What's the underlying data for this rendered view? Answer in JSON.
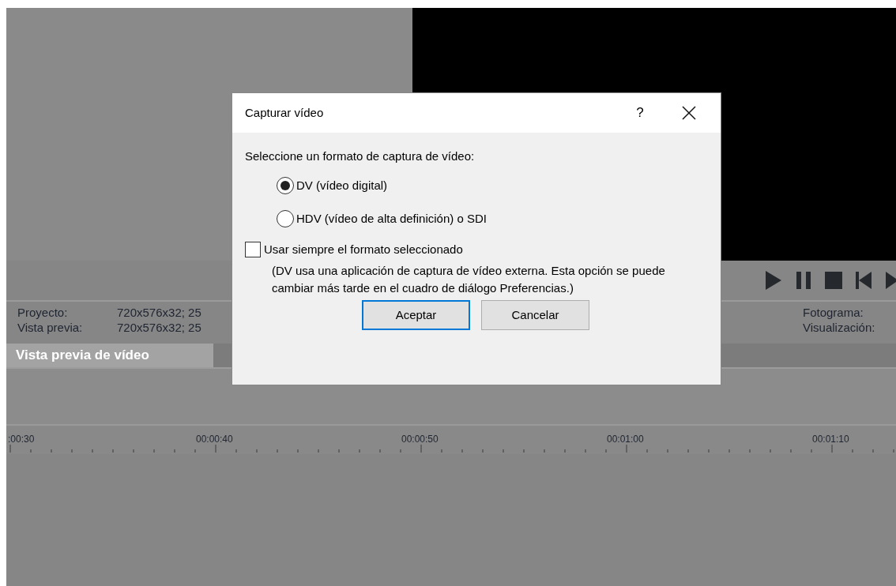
{
  "preview_info": {
    "rows": [
      {
        "label": "Proyecto:",
        "value": "720x576x32; 25"
      },
      {
        "label": "Vista previa:",
        "value": "720x576x32; 25"
      }
    ],
    "right_labels": [
      "Fotograma:",
      "Visualización:"
    ]
  },
  "tabs": [
    {
      "label": "Vista previa de vídeo",
      "selected": true
    }
  ],
  "timeline": {
    "ruler_labels": [
      ":00:30",
      "00:00:40",
      "00:00:50",
      "00:01:00",
      "00:01:10"
    ]
  },
  "dialog": {
    "title": "Capturar vídeo",
    "help": "?",
    "prompt": "Seleccione un formato de captura de vídeo:",
    "options": [
      {
        "label": "DV (vídeo digital)",
        "selected": true
      },
      {
        "label": "HDV (vídeo de alta definición) o SDI",
        "selected": false
      }
    ],
    "checkbox": {
      "label": "Usar siempre el formato seleccionado",
      "checked": false
    },
    "note": "(DV usa una aplicación de captura de vídeo externa. Esta opción se puede cambiar más tarde en el cuadro de diálogo Preferencias.)",
    "buttons": [
      {
        "label": "Aceptar",
        "default": true
      },
      {
        "label": "Cancelar",
        "default": false
      }
    ]
  }
}
